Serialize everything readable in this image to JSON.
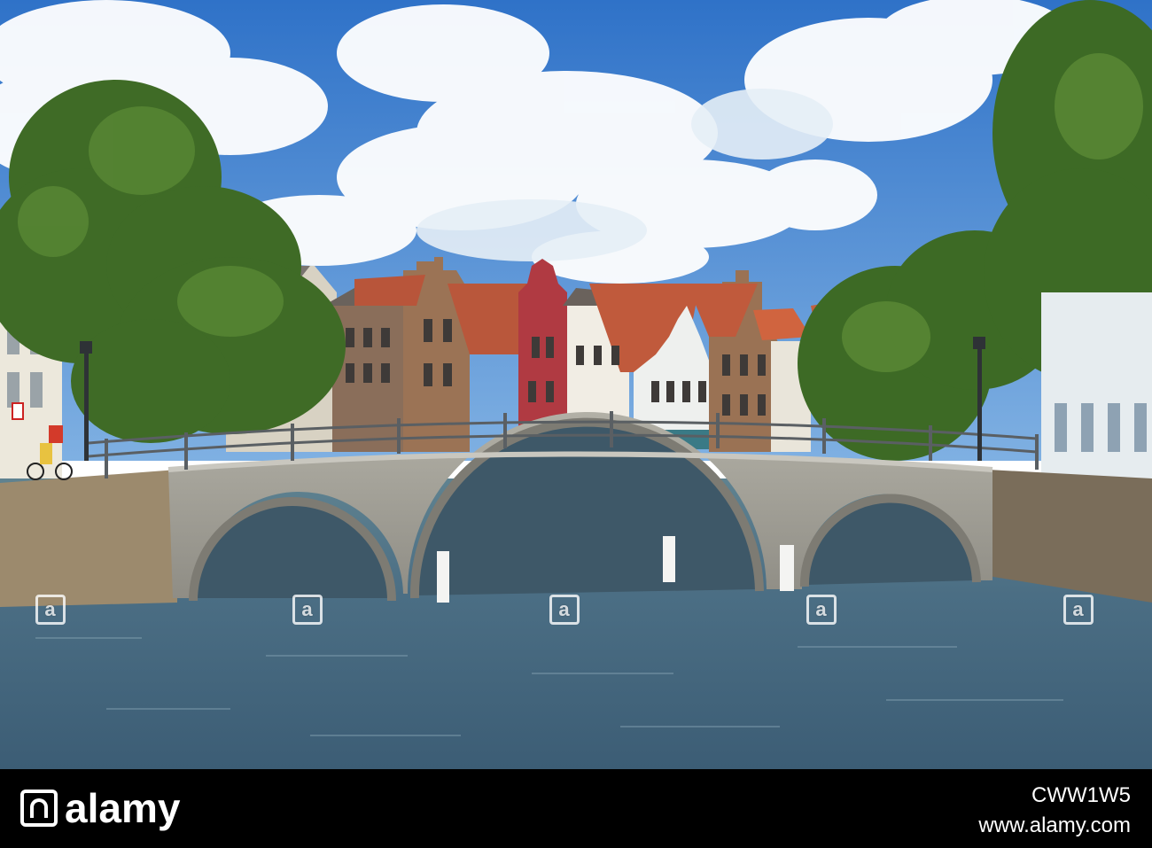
{
  "photo": {
    "subject": "stone-arch-bridge-over-canal",
    "colors": {
      "sky": "#3d7fd1",
      "water": "#4c6f85",
      "stone": "#a7a59c",
      "roof": "#c05a3c",
      "foliage": "#3f6b26"
    },
    "watermarks": [
      {
        "text": "a"
      },
      {
        "text": "a"
      },
      {
        "text": "a"
      },
      {
        "text": "a"
      },
      {
        "text": "a"
      }
    ]
  },
  "footer": {
    "logo_text": "alamy",
    "image_id": "CWW1W5",
    "site": "www.alamy.com"
  }
}
